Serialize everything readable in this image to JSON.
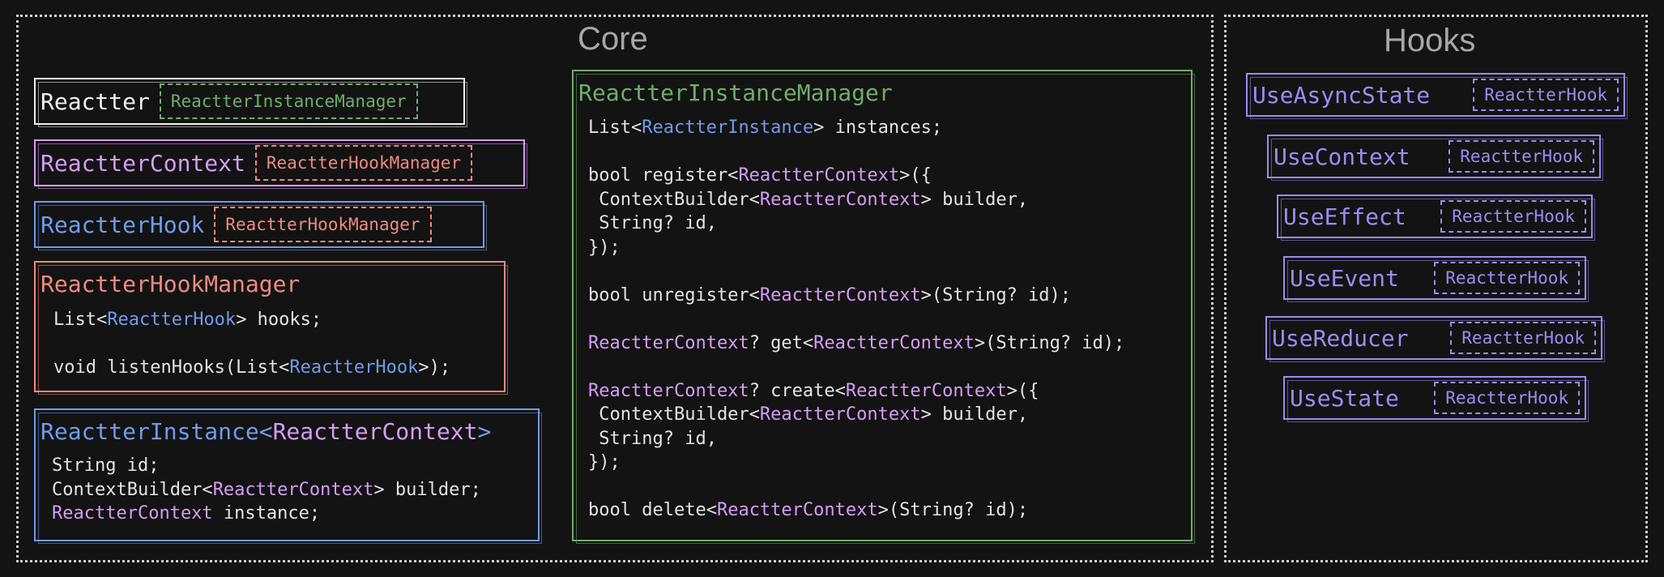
{
  "sections": {
    "core_title": "Core",
    "hooks_title": "Hooks"
  },
  "colors": {
    "white": "#f0f0f0",
    "blue": "#6f9ceb",
    "pink": "#d69cf4",
    "green": "#6fae6a",
    "salmon": "#ef8a80",
    "purple": "#9b8cf3"
  },
  "core_left": {
    "reactter": {
      "name": "Reactter",
      "tag": "ReactterInstanceManager"
    },
    "reactter_context": {
      "name": "ReactterContext",
      "tag": "ReactterHookManager"
    },
    "reactter_hook": {
      "name": "ReactterHook",
      "tag": "ReactterHookManager"
    },
    "hook_manager": {
      "title": "ReactterHookManager",
      "lines": [
        [
          {
            "t": "List<"
          },
          {
            "t": "ReactterHook",
            "c": "blue"
          },
          {
            "t": "> hooks;"
          }
        ],
        [],
        [
          {
            "t": "void listenHooks(List<"
          },
          {
            "t": "ReactterHook",
            "c": "blue"
          },
          {
            "t": ">);"
          }
        ]
      ]
    },
    "instance": {
      "title_main": "ReactterInstance<",
      "title_generic": "ReactterContext",
      "title_close": ">",
      "lines": [
        [
          {
            "t": "String id;"
          }
        ],
        [
          {
            "t": "ContextBuilder<"
          },
          {
            "t": "ReactterContext",
            "c": "pink"
          },
          {
            "t": "> builder;"
          }
        ],
        [
          {
            "t": "ReactterContext",
            "c": "pink"
          },
          {
            "t": " instance;"
          }
        ]
      ]
    }
  },
  "instance_manager": {
    "title": "ReactterInstanceManager",
    "lines": [
      [
        {
          "t": "List<"
        },
        {
          "t": "ReactterInstance",
          "c": "blue"
        },
        {
          "t": "> instances;"
        }
      ],
      [],
      [
        {
          "t": "bool register<"
        },
        {
          "t": "ReactterContext",
          "c": "pink"
        },
        {
          "t": ">({"
        }
      ],
      [
        {
          "t": " ContextBuilder<"
        },
        {
          "t": "ReactterContext",
          "c": "pink"
        },
        {
          "t": "> builder,"
        }
      ],
      [
        {
          "t": " String? id,"
        }
      ],
      [
        {
          "t": "});"
        }
      ],
      [],
      [
        {
          "t": "bool unregister<"
        },
        {
          "t": "ReactterContext",
          "c": "pink"
        },
        {
          "t": ">(String? id);"
        }
      ],
      [],
      [
        {
          "t": "ReactterContext",
          "c": "pink"
        },
        {
          "t": "? get<"
        },
        {
          "t": "ReactterContext",
          "c": "pink"
        },
        {
          "t": ">(String? id);"
        }
      ],
      [],
      [
        {
          "t": "ReactterContext",
          "c": "pink"
        },
        {
          "t": "? create<"
        },
        {
          "t": "ReactterContext",
          "c": "pink"
        },
        {
          "t": ">({"
        }
      ],
      [
        {
          "t": " ContextBuilder<"
        },
        {
          "t": "ReactterContext",
          "c": "pink"
        },
        {
          "t": "> builder,"
        }
      ],
      [
        {
          "t": " String? id,"
        }
      ],
      [
        {
          "t": "});"
        }
      ],
      [],
      [
        {
          "t": "bool delete<"
        },
        {
          "t": "ReactterContext",
          "c": "pink"
        },
        {
          "t": ">(String? id);"
        }
      ]
    ]
  },
  "hooks": [
    {
      "name": "UseAsyncState",
      "tag": "ReactterHook"
    },
    {
      "name": "UseContext",
      "tag": "ReactterHook"
    },
    {
      "name": "UseEffect",
      "tag": "ReactterHook"
    },
    {
      "name": "UseEvent",
      "tag": "ReactterHook"
    },
    {
      "name": "UseReducer",
      "tag": "ReactterHook"
    },
    {
      "name": "UseState",
      "tag": "ReactterHook"
    }
  ]
}
